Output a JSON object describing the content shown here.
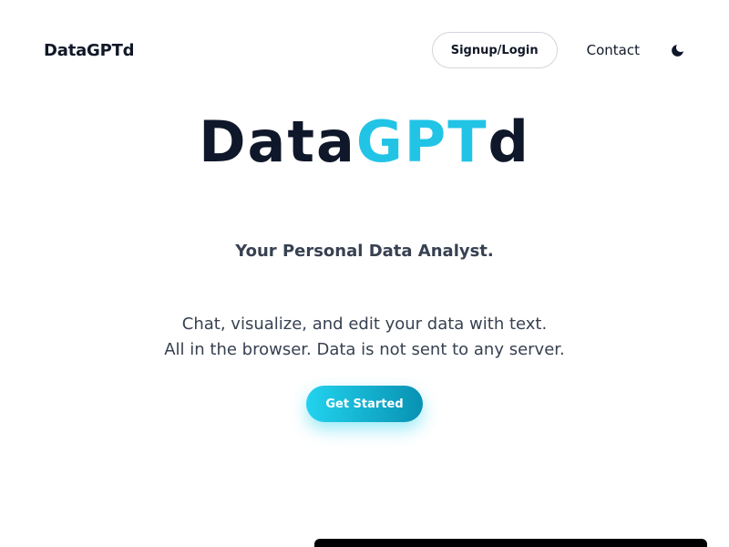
{
  "header": {
    "brand": "DataGPTd",
    "signup_label": "Signup/Login",
    "contact_label": "Contact",
    "theme_icon": "moon-icon"
  },
  "hero": {
    "title_part1": "Data",
    "title_part2": "GPT",
    "title_part3": "d",
    "tagline": "Your Personal Data Analyst.",
    "description_line1": "Chat, visualize, and edit your data with text.",
    "description_line2": "All in the browser. Data is not sent to any server.",
    "cta_label": "Get Started"
  },
  "colors": {
    "dark": "#0f172a",
    "accent": "#22c4e6",
    "cta_gradient_start": "#22d3ee",
    "cta_gradient_end": "#0891b2"
  }
}
